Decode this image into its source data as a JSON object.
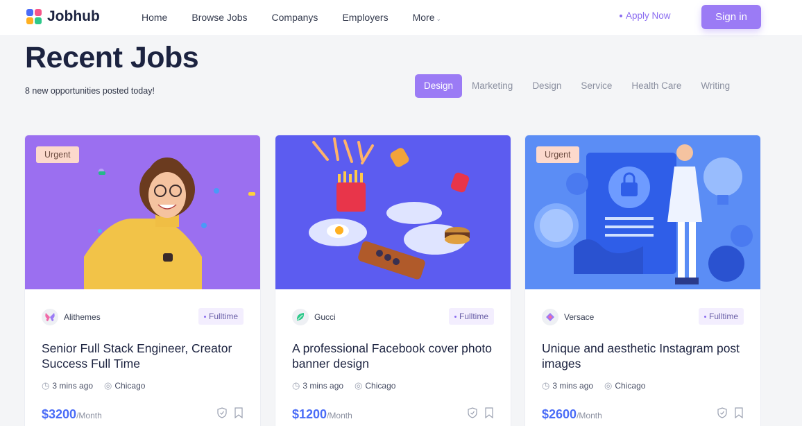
{
  "header": {
    "brand": "Jobhub",
    "nav": [
      {
        "label": "Home"
      },
      {
        "label": "Browse Jobs"
      },
      {
        "label": "Companys"
      },
      {
        "label": "Employers"
      },
      {
        "label": "More"
      }
    ],
    "apply_label": "Apply Now",
    "signin_label": "Sign in"
  },
  "hero": {
    "title": "Recent Jobs",
    "subtitle": "8 new opportunities posted today!",
    "tabs": [
      "Design",
      "Marketing",
      "Design",
      "Service",
      "Health Care",
      "Writing"
    ],
    "active_tab": "Design"
  },
  "jobs": [
    {
      "urgent": "Urgent",
      "company": "Alithemes",
      "type": "Fulltime",
      "title": "Senior Full Stack Engineer, Creator Success Full Time",
      "posted": "3 mins ago",
      "location": "Chicago",
      "price": "$3200",
      "period": "/Month"
    },
    {
      "urgent": "",
      "company": "Gucci",
      "type": "Fulltime",
      "title": "A professional Facebook cover photo banner design",
      "posted": "3 mins ago",
      "location": "Chicago",
      "price": "$1200",
      "period": "/Month"
    },
    {
      "urgent": "Urgent",
      "company": "Versace",
      "type": "Fulltime",
      "title": "Unique and aesthetic Instagram post images",
      "posted": "3 mins ago",
      "location": "Chicago",
      "price": "$2600",
      "period": "/Month"
    }
  ],
  "colors": {
    "accent": "#9b7bf5",
    "price": "#4a6cf7",
    "urgent_bg": "#fcd9cc"
  }
}
